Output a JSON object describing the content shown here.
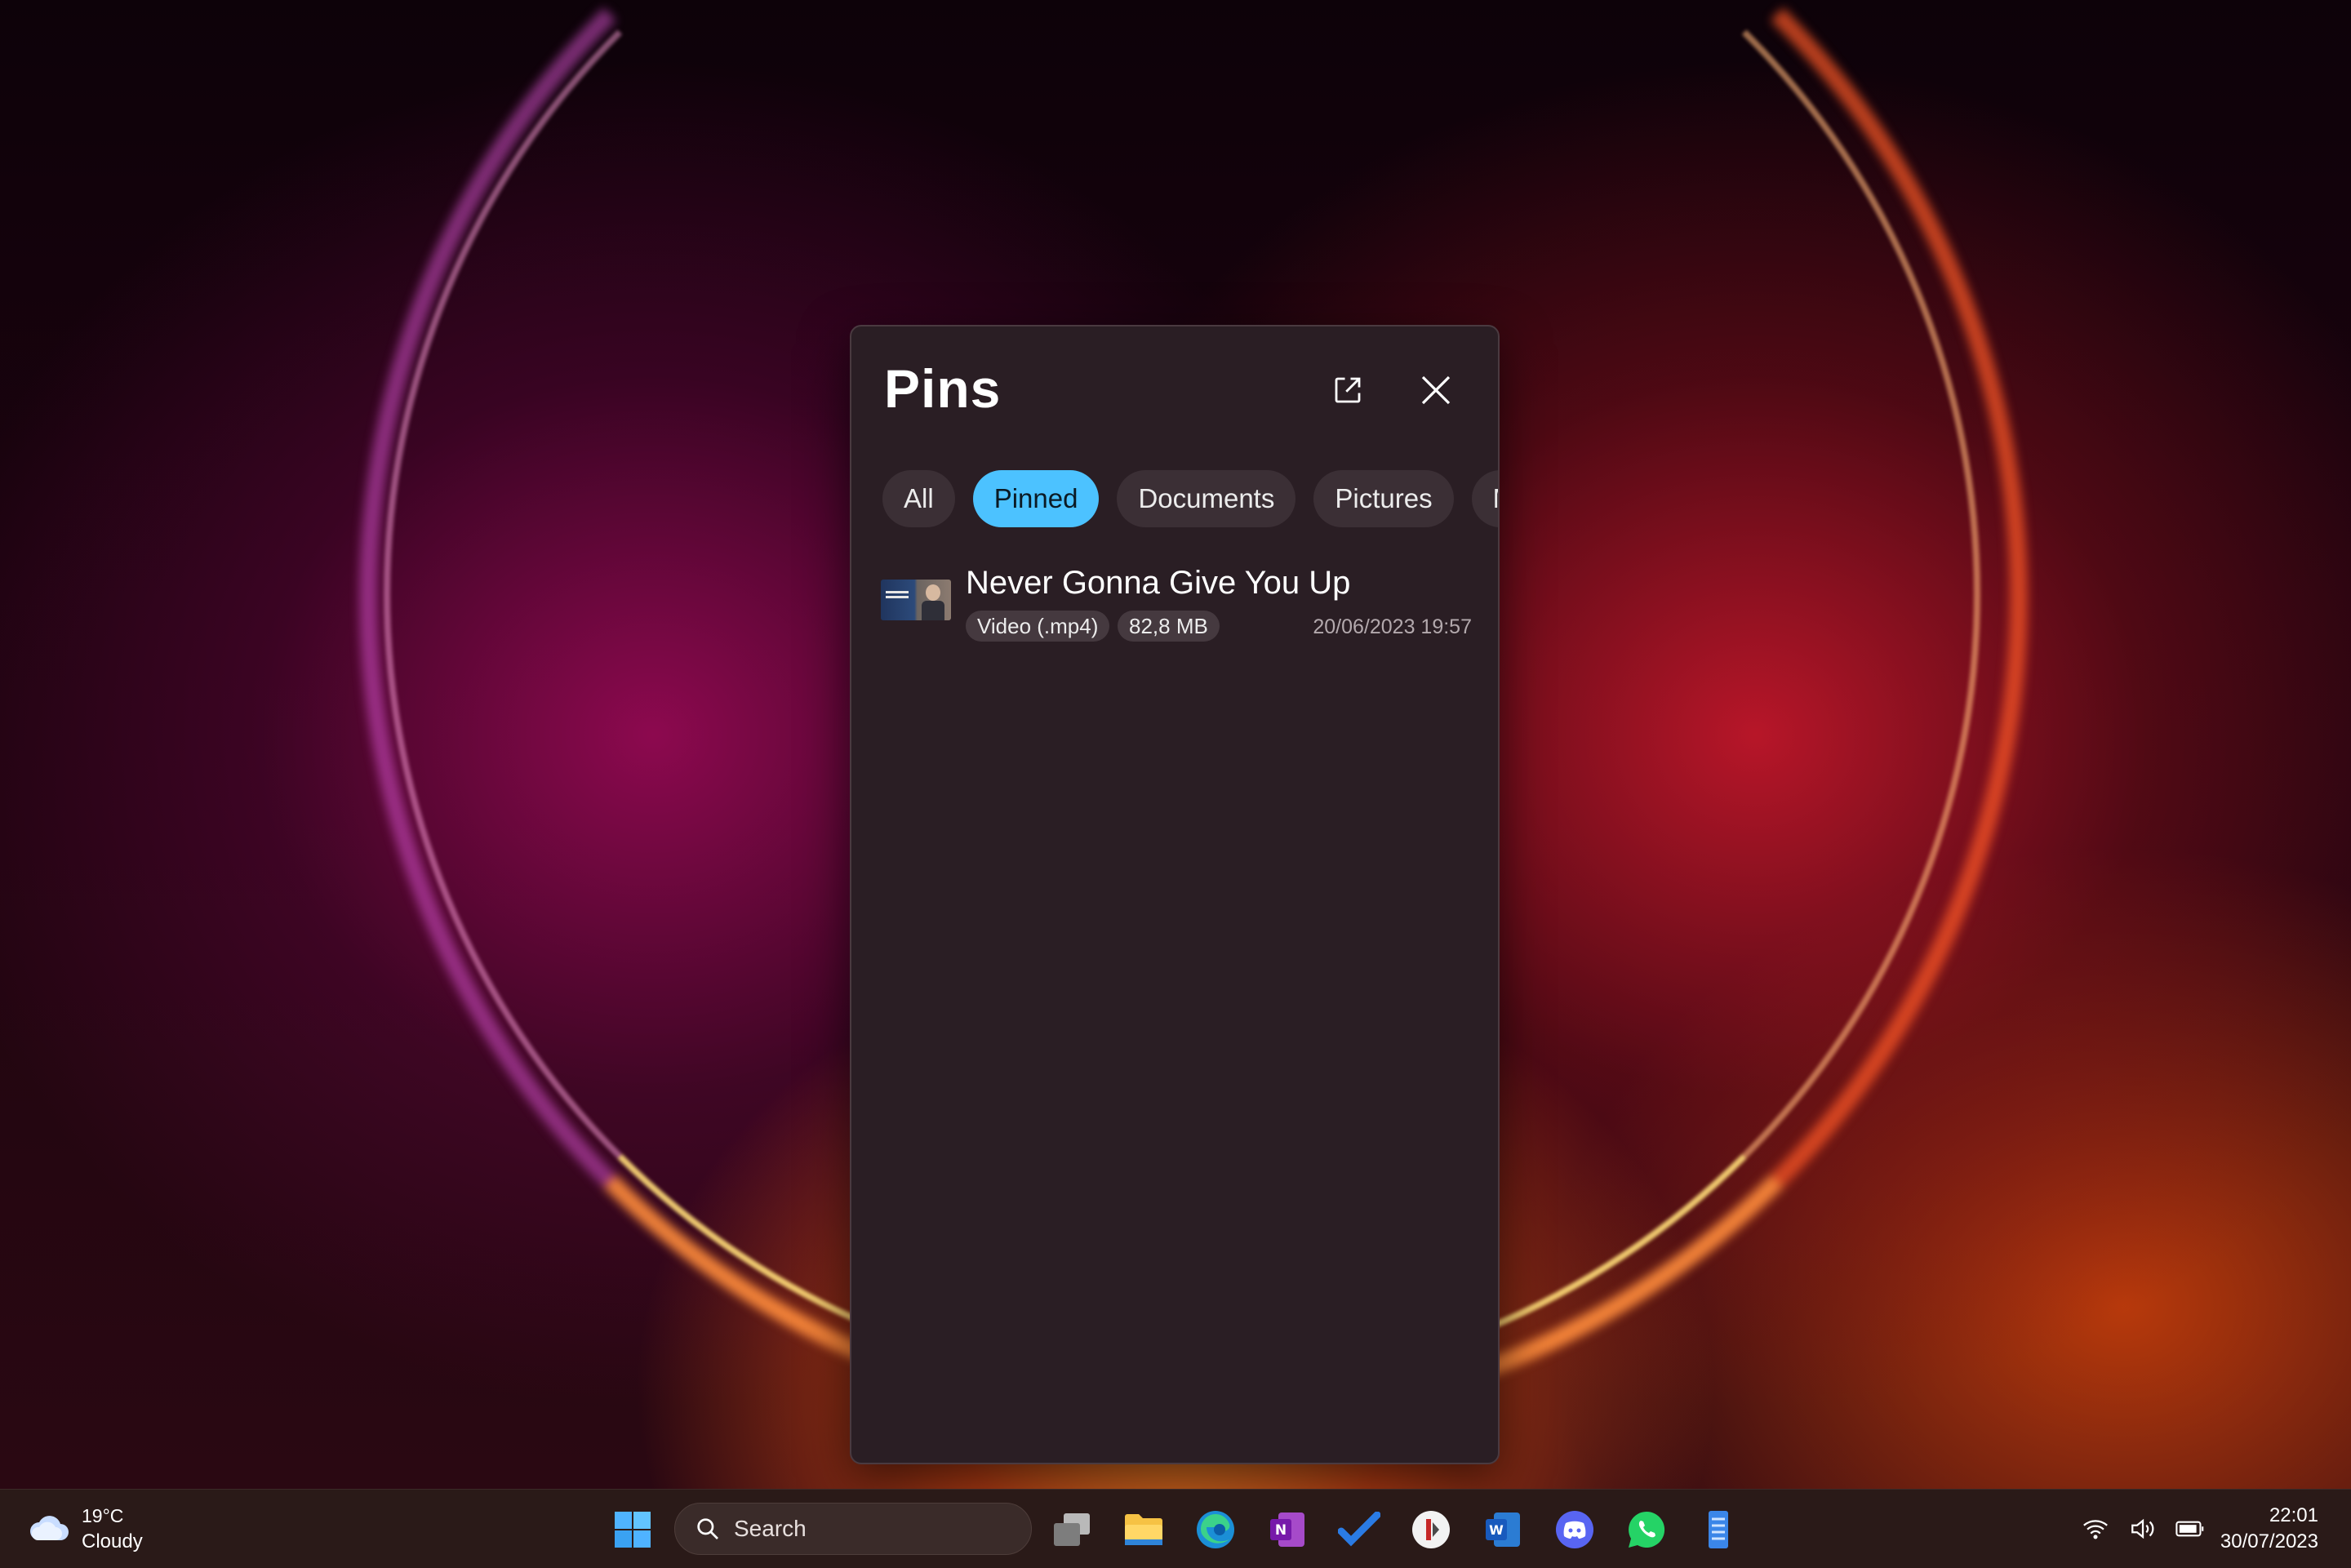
{
  "flyout": {
    "title": "Pins",
    "popout_icon": "open-in-new-window-icon",
    "close_icon": "close-icon",
    "filters": [
      {
        "label": "All",
        "active": false
      },
      {
        "label": "Pinned",
        "active": true
      },
      {
        "label": "Documents",
        "active": false
      },
      {
        "label": "Pictures",
        "active": false
      },
      {
        "label": "Music",
        "active": false
      }
    ],
    "items": [
      {
        "title": "Never Gonna Give You Up",
        "type_label": "Video (.mp4)",
        "size_label": "82,8 MB",
        "date": "20/06/2023 19:57"
      }
    ]
  },
  "taskbar": {
    "weather": {
      "temp": "19°C",
      "condition": "Cloudy",
      "icon": "cloud-icon"
    },
    "search_label": "Search",
    "apps": [
      "windows-start-icon",
      "task-view-icon",
      "file-explorer-icon",
      "edge-icon",
      "onenote-icon",
      "todo-icon",
      "app-icon",
      "word-icon",
      "discord-icon",
      "whatsapp-icon",
      "notepad-icon"
    ],
    "tray": [
      "wifi-icon",
      "volume-icon",
      "battery-icon"
    ],
    "clock": {
      "time": "22:01",
      "date": "30/07/2023"
    }
  },
  "colors": {
    "accent": "#4cc2ff",
    "flyout_bg": "#2a1e24",
    "chip_bg": "#3b2f35"
  }
}
